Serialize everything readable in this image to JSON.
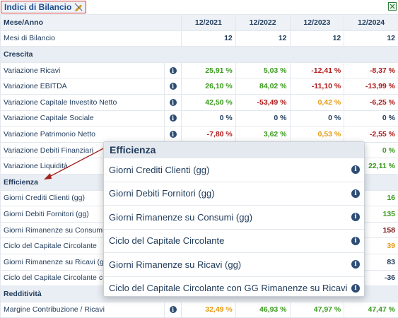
{
  "title": "Indici di Bilancio",
  "header": {
    "label": "Mese/Anno",
    "years": [
      "12/2021",
      "12/2022",
      "12/2023",
      "12/2024"
    ]
  },
  "months": {
    "label": "Mesi di Bilancio",
    "values": [
      "12",
      "12",
      "12",
      "12"
    ]
  },
  "rows": [
    {
      "type": "section",
      "label": "Crescita"
    },
    {
      "type": "row",
      "label": "Variazione Ricavi",
      "info": true,
      "values": [
        {
          "v": "25,91 %",
          "c": "green"
        },
        {
          "v": "5,03 %",
          "c": "green"
        },
        {
          "v": "-12,41 %",
          "c": "red"
        },
        {
          "v": "-8,37 %",
          "c": "red"
        }
      ]
    },
    {
      "type": "row",
      "label": "Variazione EBITDA",
      "info": true,
      "values": [
        {
          "v": "26,10 %",
          "c": "green"
        },
        {
          "v": "84,02 %",
          "c": "green"
        },
        {
          "v": "-11,10 %",
          "c": "red"
        },
        {
          "v": "-13,99 %",
          "c": "red"
        }
      ]
    },
    {
      "type": "row",
      "label": "Variazione Capitale Investito Netto",
      "info": true,
      "values": [
        {
          "v": "42,50 %",
          "c": "green"
        },
        {
          "v": "-53,49 %",
          "c": "red"
        },
        {
          "v": "0,42 %",
          "c": "orange"
        },
        {
          "v": "-6,25 %",
          "c": "red"
        }
      ]
    },
    {
      "type": "row",
      "label": "Variazione Capitale Sociale",
      "info": true,
      "values": [
        {
          "v": "0 %",
          "c": "dark"
        },
        {
          "v": "0 %",
          "c": "dark"
        },
        {
          "v": "0 %",
          "c": "dark"
        },
        {
          "v": "0 %",
          "c": "dark"
        }
      ]
    },
    {
      "type": "row",
      "label": "Variazione Patrimonio Netto",
      "info": true,
      "values": [
        {
          "v": "-7,80 %",
          "c": "red"
        },
        {
          "v": "3,62 %",
          "c": "green"
        },
        {
          "v": "0,53 %",
          "c": "orange"
        },
        {
          "v": "-2,55 %",
          "c": "red"
        }
      ]
    },
    {
      "type": "row",
      "label": "Variazione Debiti Finanziari",
      "info": false,
      "values": [
        {
          "v": "",
          "c": "dark"
        },
        {
          "v": "",
          "c": "dark"
        },
        {
          "v": "",
          "c": "dark"
        },
        {
          "v": "0 %",
          "c": "green"
        }
      ]
    },
    {
      "type": "row",
      "label": "Variazione Liquidità",
      "info": false,
      "values": [
        {
          "v": "",
          "c": "dark"
        },
        {
          "v": "",
          "c": "dark"
        },
        {
          "v": "",
          "c": "dark"
        },
        {
          "v": "22,11 %",
          "c": "green"
        }
      ]
    },
    {
      "type": "section",
      "label": "Efficienza"
    },
    {
      "type": "row",
      "label": "Giorni Crediti Clienti (gg)",
      "info": false,
      "values": [
        {
          "v": "",
          "c": "dark"
        },
        {
          "v": "",
          "c": "dark"
        },
        {
          "v": "",
          "c": "dark"
        },
        {
          "v": "16",
          "c": "green"
        }
      ]
    },
    {
      "type": "row",
      "label": "Giorni Debiti Fornitori (gg)",
      "info": false,
      "values": [
        {
          "v": "",
          "c": "dark"
        },
        {
          "v": "",
          "c": "dark"
        },
        {
          "v": "",
          "c": "dark"
        },
        {
          "v": "135",
          "c": "green"
        }
      ]
    },
    {
      "type": "row",
      "label": "Giorni Rimanenze su Consumi (gg)",
      "info": false,
      "values": [
        {
          "v": "",
          "c": "dark"
        },
        {
          "v": "",
          "c": "dark"
        },
        {
          "v": "",
          "c": "dark"
        },
        {
          "v": "158",
          "c": "maroon"
        }
      ]
    },
    {
      "type": "row",
      "label": "Ciclo del Capitale Circolante",
      "info": false,
      "values": [
        {
          "v": "",
          "c": "dark"
        },
        {
          "v": "",
          "c": "dark"
        },
        {
          "v": "",
          "c": "dark"
        },
        {
          "v": "39",
          "c": "gold"
        }
      ]
    },
    {
      "type": "row",
      "label": "Giorni Rimanenze su Ricavi (gg)",
      "info": false,
      "values": [
        {
          "v": "",
          "c": "dark"
        },
        {
          "v": "",
          "c": "dark"
        },
        {
          "v": "",
          "c": "dark"
        },
        {
          "v": "83",
          "c": "dark"
        }
      ]
    },
    {
      "type": "row",
      "label": "Ciclo del Capitale Circolante con GG",
      "info": false,
      "values": [
        {
          "v": "",
          "c": "dark"
        },
        {
          "v": "",
          "c": "dark"
        },
        {
          "v": "",
          "c": "dark"
        },
        {
          "v": "-36",
          "c": "dark"
        }
      ]
    },
    {
      "type": "section",
      "label": "Redditività"
    },
    {
      "type": "row",
      "label": "Margine Contribuzione / Ricavi",
      "info": true,
      "values": [
        {
          "v": "32,49 %",
          "c": "orange"
        },
        {
          "v": "46,93 %",
          "c": "green"
        },
        {
          "v": "47,97 %",
          "c": "green"
        },
        {
          "v": "47,47 %",
          "c": "green"
        }
      ]
    }
  ],
  "popup": {
    "title": "Efficienza",
    "items": [
      "Giorni Crediti Clienti (gg)",
      "Giorni Debiti Fornitori (gg)",
      "Giorni Rimanenze su Consumi (gg)",
      "Ciclo del Capitale Circolante",
      "Giorni Rimanenze su Ricavi (gg)",
      "Ciclo del Capitale Circolante con GG Rimanenze su Ricavi"
    ]
  },
  "colors": {
    "green": "#3a9a1e",
    "red": "#b01a1a",
    "orange": "#e49a12",
    "annotation": "#d8322b"
  }
}
